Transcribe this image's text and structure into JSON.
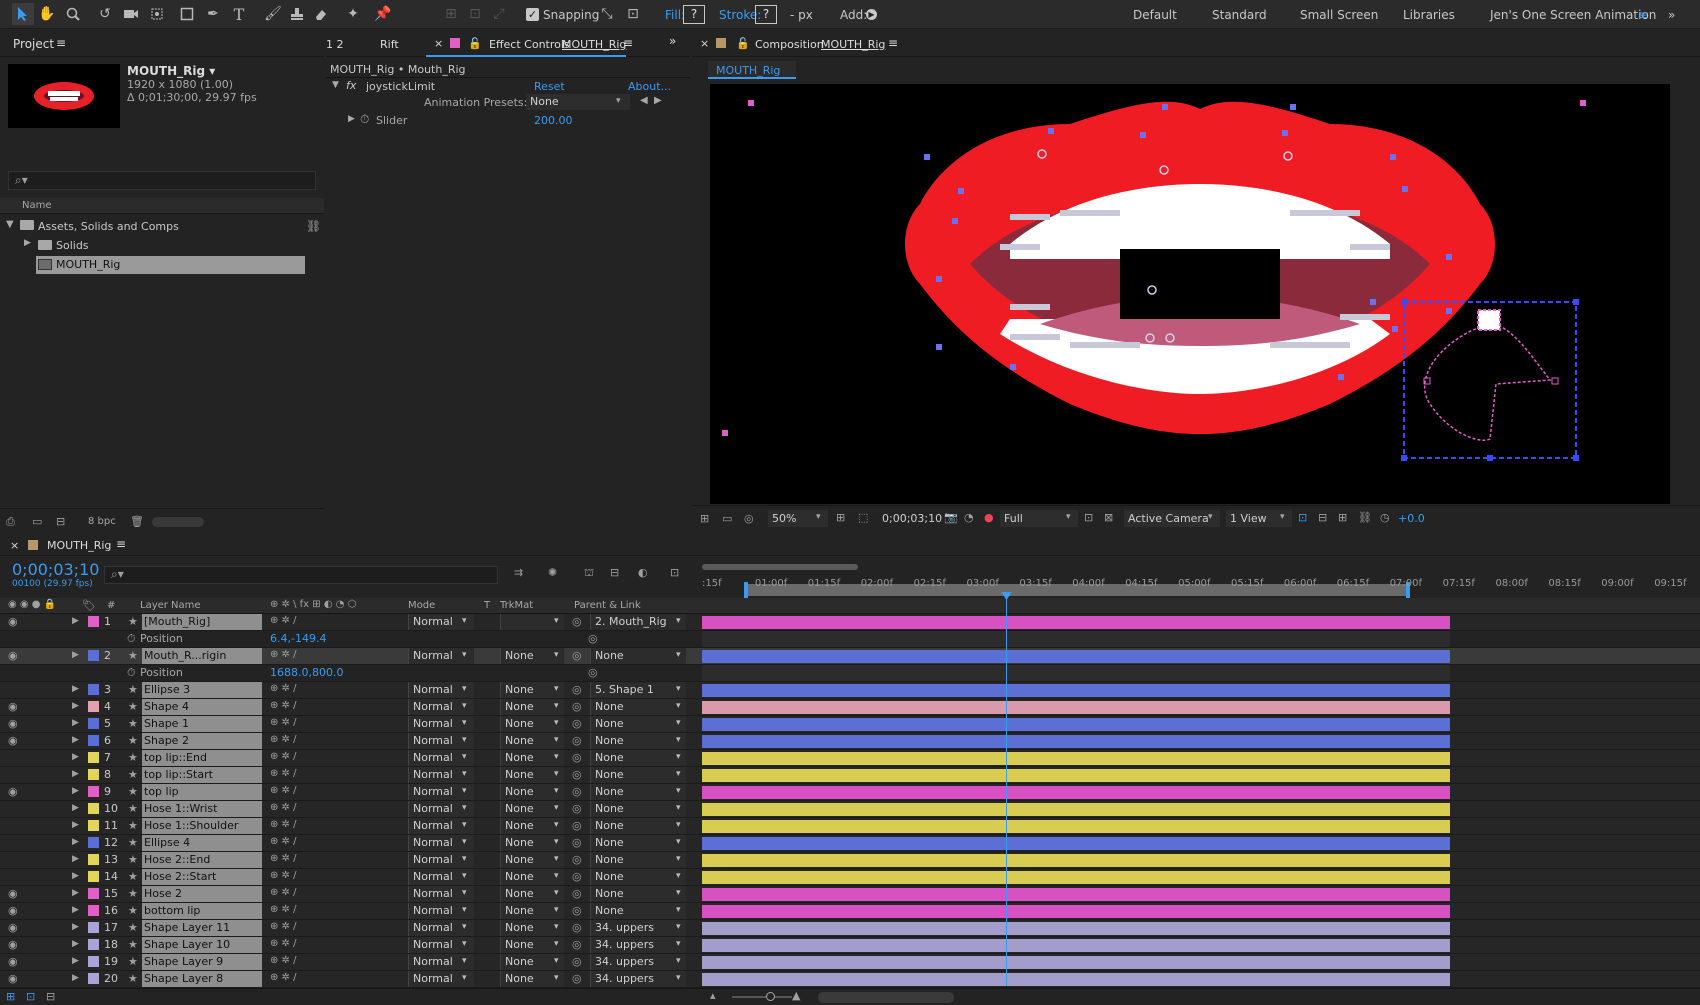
{
  "toolbar": {
    "snapping": "Snapping",
    "fill": "Fill:",
    "stroke": "Stroke:",
    "stroke_unit": "- px",
    "add": "Add:",
    "q": "?"
  },
  "workspaces": [
    "Default",
    "Standard",
    "Small Screen",
    "Libraries",
    "Jen's One Screen Animation"
  ],
  "project": {
    "title": "Project",
    "comp_name": "MOUTH_Rig ▾",
    "comp_size": "1920 x 1080 (1.00)",
    "comp_duration": "Δ 0;01;30;00, 29.97 fps",
    "col_name": "Name",
    "bpc": "8 bpc",
    "items": [
      {
        "label": "Assets, Solids and Comps"
      },
      {
        "label": "Solids"
      },
      {
        "label": "MOUTH_Rig"
      }
    ]
  },
  "effects": {
    "tab_num": "1 2",
    "tab_rift": "Rift",
    "tab_title": "Effect Controls",
    "tab_comp": "MOUTH_Rig",
    "breadcrumb": "MOUTH_Rig • Mouth_Rig",
    "effect_name": "joystickLimit",
    "reset": "Reset",
    "about": "About...",
    "presets_label": "Animation Presets:",
    "presets_value": "None",
    "slider_label": "Slider",
    "slider_value": "200.00"
  },
  "comp": {
    "title": "Composition",
    "name": "MOUTH_Rig",
    "tab": "MOUTH_Rig",
    "zoom": "50%",
    "timecode": "0;00;03;10",
    "resolution": "Full",
    "camera": "Active Camera",
    "view": "1 View",
    "exposure": "+0.0"
  },
  "timeline": {
    "comp": "MOUTH_Rig",
    "timecode": "0;00;03;10",
    "fps": "00100 (29.97 fps)",
    "cols": {
      "num": "#",
      "name": "Layer Name",
      "mode": "Mode",
      "t": "T",
      "trkmat": "TrkMat",
      "parent": "Parent & Link"
    },
    "ruler": [
      ":15f",
      "01:00f",
      "01:15f",
      "02:00f",
      "02:15f",
      "03:00f",
      "03:15f",
      "04:00f",
      "04:15f",
      "05:00f",
      "05:15f",
      "06:00f",
      "06:15f",
      "07:00f",
      "07:15f",
      "08:00f",
      "08:15f",
      "09:00f",
      "09:15f"
    ],
    "layers": [
      {
        "num": "1",
        "name": "[Mouth_Rig]",
        "mode": "Normal",
        "trk": "",
        "parent": "2. Mouth_Rig",
        "color": "#e060c8",
        "bar": "#d851c3",
        "eye": true,
        "sel": false
      },
      {
        "prop": true,
        "label": "Position",
        "value": "6.4,-149.4"
      },
      {
        "num": "2",
        "name": "Mouth_R...rigin",
        "mode": "Normal",
        "trk": "None",
        "parent": "None",
        "color": "#5a6fd6",
        "bar": "#5b6fd4",
        "eye": true,
        "sel": true
      },
      {
        "prop": true,
        "label": "Position",
        "value": "1688.0,800.0"
      },
      {
        "num": "3",
        "name": "Ellipse 3",
        "mode": "Normal",
        "trk": "None",
        "parent": "5. Shape 1",
        "color": "#5a6fd6",
        "bar": "#5b6fd4",
        "eye": false
      },
      {
        "num": "4",
        "name": "Shape 4",
        "mode": "Normal",
        "trk": "None",
        "parent": "None",
        "color": "#e3a0b0",
        "bar": "#d99aab",
        "eye": true
      },
      {
        "num": "5",
        "name": "Shape 1",
        "mode": "Normal",
        "trk": "None",
        "parent": "None",
        "color": "#5a6fd6",
        "bar": "#5b6fd4",
        "eye": true
      },
      {
        "num": "6",
        "name": "Shape 2",
        "mode": "Normal",
        "trk": "None",
        "parent": "None",
        "color": "#5a6fd6",
        "bar": "#5b6fd4",
        "eye": true
      },
      {
        "num": "7",
        "name": "top lip::End",
        "mode": "Normal",
        "trk": "None",
        "parent": "None",
        "color": "#e2d65a",
        "bar": "#d8cc52",
        "eye": false
      },
      {
        "num": "8",
        "name": "top lip::Start",
        "mode": "Normal",
        "trk": "None",
        "parent": "None",
        "color": "#e2d65a",
        "bar": "#d8cc52",
        "eye": false
      },
      {
        "num": "9",
        "name": "top lip",
        "mode": "Normal",
        "trk": "None",
        "parent": "None",
        "color": "#e060c8",
        "bar": "#d851c3",
        "eye": true
      },
      {
        "num": "10",
        "name": "Hose 1::Wrist",
        "mode": "Normal",
        "trk": "None",
        "parent": "None",
        "color": "#e2d65a",
        "bar": "#d8cc52",
        "eye": false
      },
      {
        "num": "11",
        "name": "Hose 1::Shoulder",
        "mode": "Normal",
        "trk": "None",
        "parent": "None",
        "color": "#e2d65a",
        "bar": "#d8cc52",
        "eye": false
      },
      {
        "num": "12",
        "name": "Ellipse 4",
        "mode": "Normal",
        "trk": "None",
        "parent": "None",
        "color": "#5a6fd6",
        "bar": "#5b6fd4",
        "eye": false
      },
      {
        "num": "13",
        "name": "Hose 2::End",
        "mode": "Normal",
        "trk": "None",
        "parent": "None",
        "color": "#e2d65a",
        "bar": "#d8cc52",
        "eye": false
      },
      {
        "num": "14",
        "name": "Hose 2::Start",
        "mode": "Normal",
        "trk": "None",
        "parent": "None",
        "color": "#e2d65a",
        "bar": "#d8cc52",
        "eye": false
      },
      {
        "num": "15",
        "name": "Hose 2",
        "mode": "Normal",
        "trk": "None",
        "parent": "None",
        "color": "#e060c8",
        "bar": "#d851c3",
        "eye": true
      },
      {
        "num": "16",
        "name": "bottom lip",
        "mode": "Normal",
        "trk": "None",
        "parent": "None",
        "color": "#e060c8",
        "bar": "#d851c3",
        "eye": true
      },
      {
        "num": "17",
        "name": "Shape Layer 11",
        "mode": "Normal",
        "trk": "None",
        "parent": "34. uppers",
        "color": "#a9a3d6",
        "bar": "#a29dca",
        "eye": true
      },
      {
        "num": "18",
        "name": "Shape Layer 10",
        "mode": "Normal",
        "trk": "None",
        "parent": "34. uppers",
        "color": "#a9a3d6",
        "bar": "#a29dca",
        "eye": true
      },
      {
        "num": "19",
        "name": "Shape Layer 9",
        "mode": "Normal",
        "trk": "None",
        "parent": "34. uppers",
        "color": "#a9a3d6",
        "bar": "#a29dca",
        "eye": true
      },
      {
        "num": "20",
        "name": "Shape Layer 8",
        "mode": "Normal",
        "trk": "None",
        "parent": "34. uppers",
        "color": "#a9a3d6",
        "bar": "#a29dca",
        "eye": true
      }
    ]
  }
}
